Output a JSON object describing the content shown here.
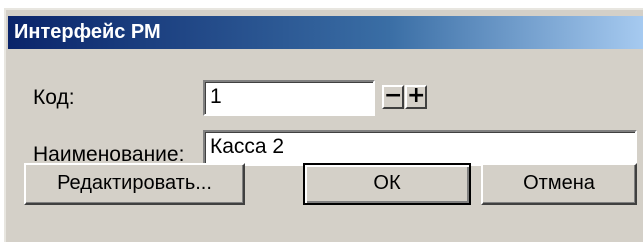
{
  "window": {
    "title": "Интерфейс РМ"
  },
  "form": {
    "code_label": "Код:",
    "code_value": "1",
    "minus_glyph": "−",
    "plus_glyph": "+",
    "name_label": "Наименование:",
    "name_value": "Касса 2"
  },
  "buttons": {
    "edit_label": "Редактировать...",
    "ok_label": "ОК",
    "cancel_label": "Отмена"
  },
  "colors": {
    "dialog_bg": "#d4d0c8",
    "titlebar_start": "#0a246a",
    "titlebar_end": "#a6caf0"
  }
}
